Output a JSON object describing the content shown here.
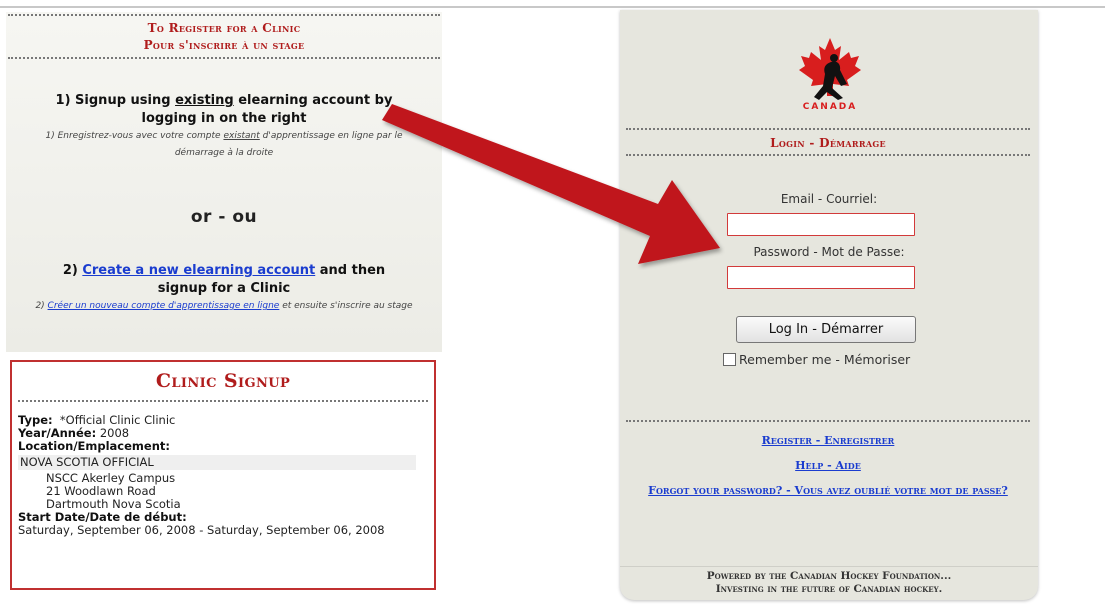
{
  "register": {
    "title_en": "To Register for a Clinic",
    "title_fr": "Pour s'inscrire à un stage",
    "step1": {
      "pre": "1) Signup using ",
      "emph": "existing",
      "post": " elearning account by logging in on the right",
      "fr_pre": "1) Enregistrez-vous avec votre compte ",
      "fr_emph": "existant",
      "fr_post": " d'apprentissage en ligne par le démarrage à la droite"
    },
    "or": "or - ou",
    "step2": {
      "pre": "2) ",
      "link": "Create a new elearning account",
      "post": " and then signup for a Clinic",
      "fr_pre": "2) ",
      "fr_link": "Créer un nouveau compte d'apprentissage en ligne",
      "fr_post": " et ensuite s'inscrire au stage"
    }
  },
  "clinic": {
    "title": "Clinic Signup",
    "type_label": "Type:",
    "type_value": "*Official Clinic Clinic",
    "year_label": "Year/Année:",
    "year_value": "2008",
    "location_label": "Location/Emplacement:",
    "location_name": "NOVA SCOTIA OFFICIAL",
    "address": [
      "NSCC Akerley Campus",
      "21 Woodlawn Road",
      "Dartmouth Nova Scotia"
    ],
    "start_label": "Start Date/Date de début:",
    "start_value": "Saturday, September 06, 2008 - Saturday, September 06, 2008"
  },
  "login": {
    "logo_text": "CANADA",
    "title": "Login - Démarrage",
    "email_label": "Email - Courriel:",
    "email_value": "",
    "password_label": "Password - Mot de Passe:",
    "password_value": "",
    "button": "Log In - Démarrer",
    "remember": "Remember me - Mémoriser"
  },
  "links": {
    "register": "Register - Enregistrer",
    "help": "Help - Aide",
    "forgot": "Forgot your password? - Vous avez oublié votre mot de passe?"
  },
  "footer": {
    "line1": "Powered by the Canadian Hockey Foundation...",
    "line2": "Investing in the future of Canadian hockey."
  },
  "colors": {
    "accent_red": "#b01c1c",
    "link_blue": "#1a3ccf",
    "panel_bg": "#e6e6de",
    "arrow_red": "#c0141c"
  }
}
